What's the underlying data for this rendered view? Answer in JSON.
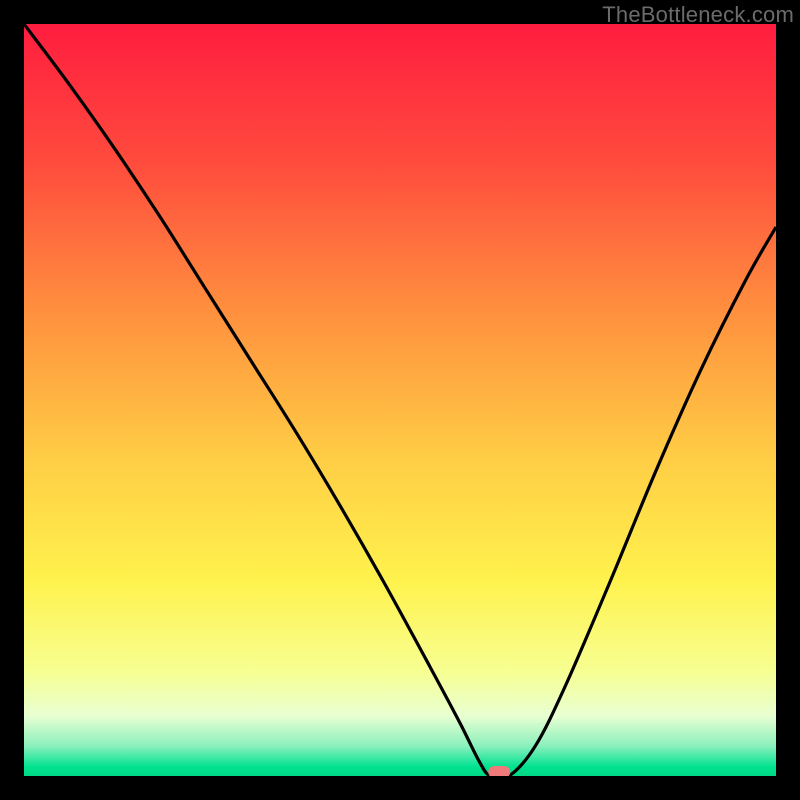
{
  "watermark": "TheBottleneck.com",
  "chart_data": {
    "type": "line",
    "title": "",
    "xlabel": "",
    "ylabel": "",
    "xlim": [
      0,
      100
    ],
    "ylim": [
      0,
      100
    ],
    "grid": false,
    "legend": false,
    "background": {
      "type": "vertical-gradient",
      "stops": [
        {
          "pct": 0,
          "color": "#ff1d3f"
        },
        {
          "pct": 18,
          "color": "#ff4a3d"
        },
        {
          "pct": 38,
          "color": "#ff8f3e"
        },
        {
          "pct": 58,
          "color": "#ffce45"
        },
        {
          "pct": 74,
          "color": "#fff24d"
        },
        {
          "pct": 86,
          "color": "#f7ff91"
        },
        {
          "pct": 92,
          "color": "#e8ffd1"
        },
        {
          "pct": 96,
          "color": "#8bf0bd"
        },
        {
          "pct": 98.8,
          "color": "#00e28f"
        },
        {
          "pct": 100,
          "color": "#00d986"
        }
      ]
    },
    "series": [
      {
        "name": "bottleneck-curve",
        "x": [
          0,
          6,
          12,
          18,
          24,
          30,
          36,
          42,
          48,
          54,
          58,
          60.5,
          62,
          64.5,
          68,
          72,
          78,
          84,
          90,
          96,
          100
        ],
        "y": [
          100,
          92,
          83.5,
          74.5,
          65,
          55.5,
          46,
          36,
          25.5,
          14.5,
          7,
          2,
          0,
          0,
          4,
          12,
          26,
          40.5,
          54,
          66,
          73
        ],
        "color": "#000000",
        "linewidth": 2
      }
    ],
    "marker": {
      "name": "min-point",
      "x": 63.2,
      "y": 0,
      "color": "#f07a7a",
      "shape": "pill"
    }
  }
}
